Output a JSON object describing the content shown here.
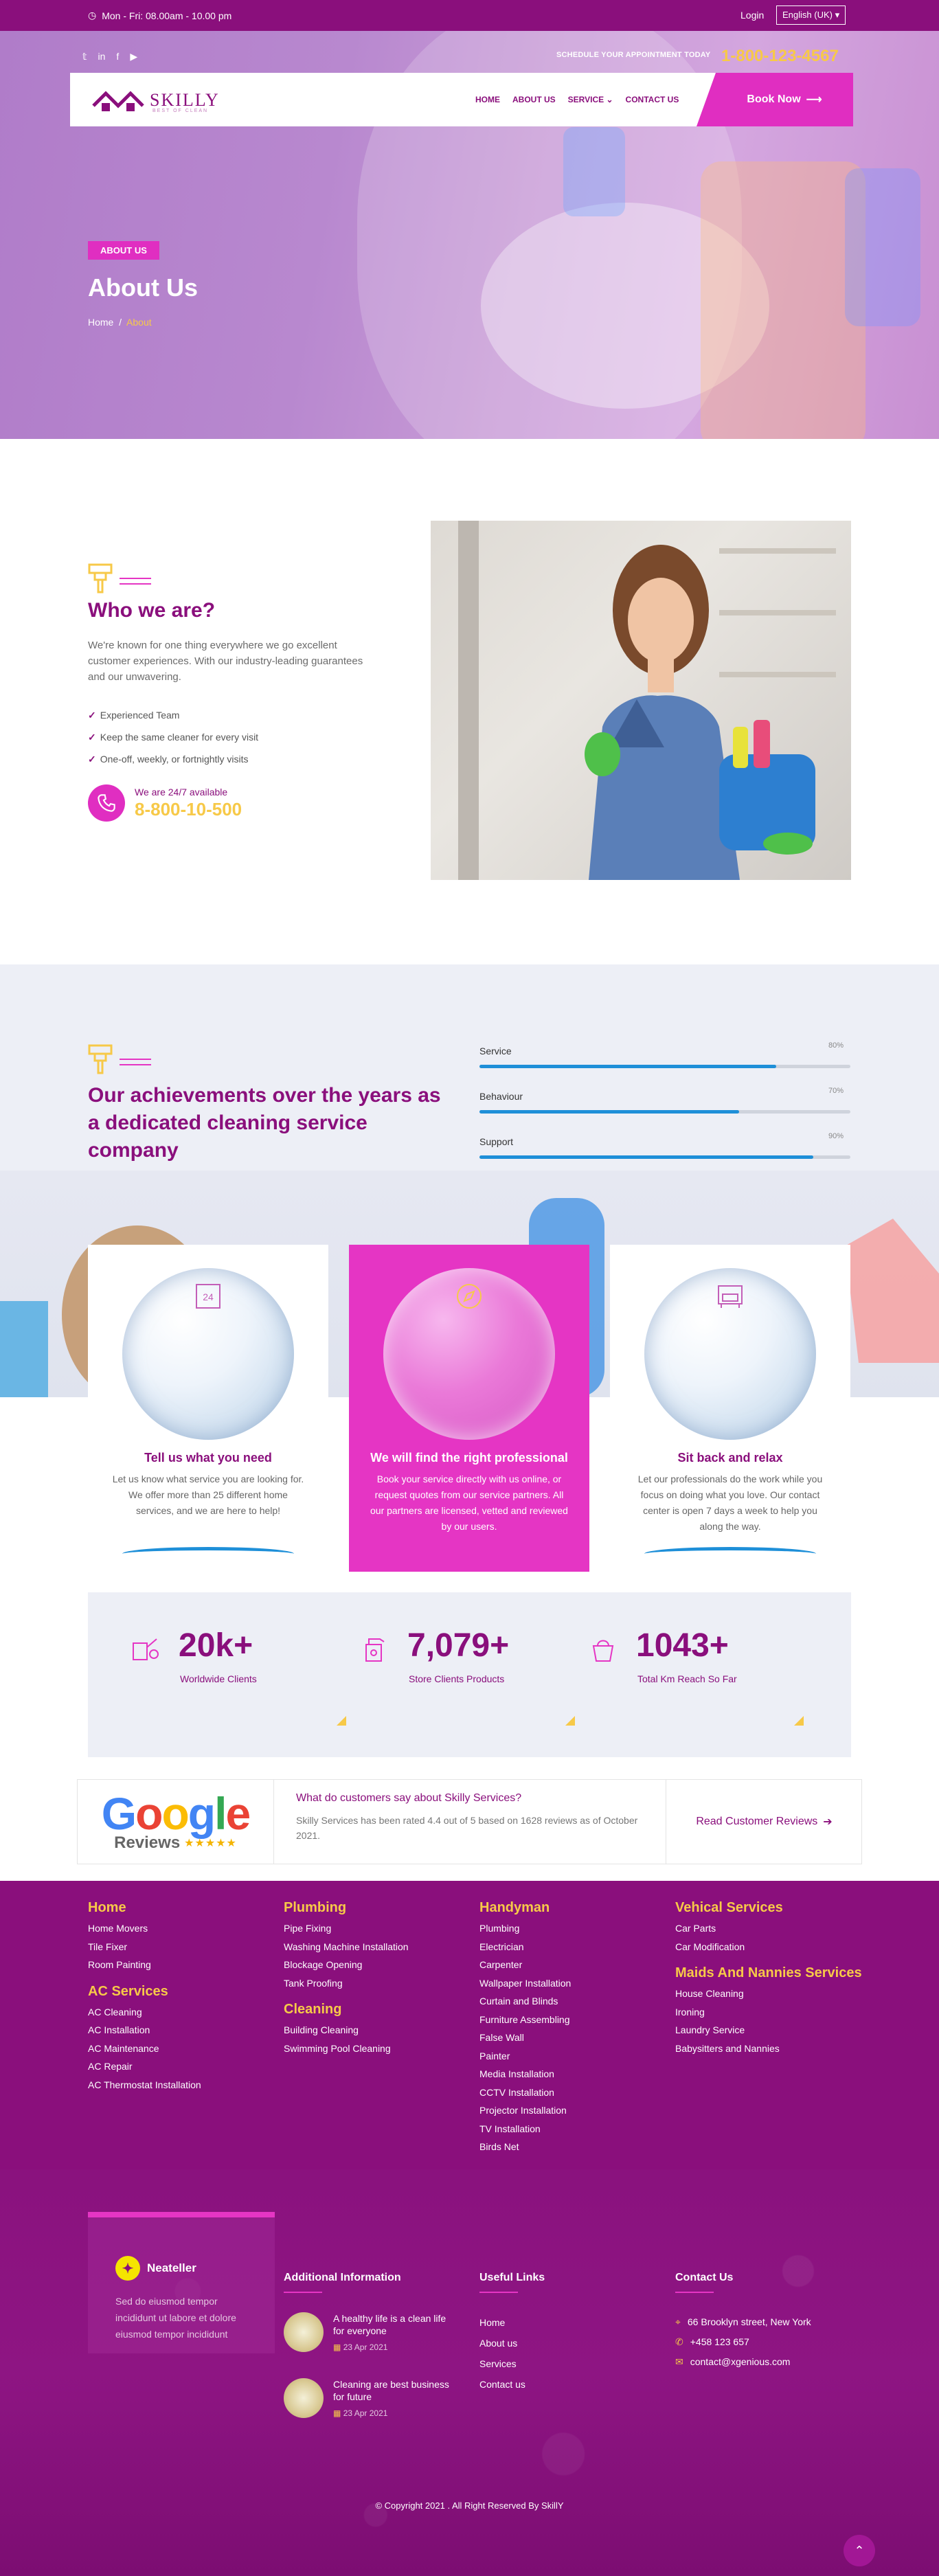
{
  "topbar": {
    "hours": "Mon - Fri: 08.00am - 10.00 pm",
    "login": "Login",
    "language": "English (UK)"
  },
  "header": {
    "schedule_label": "SCHEDULE YOUR APPOINTMENT TODAY",
    "phone": "1-800-123-4567",
    "logo_name": "SKILLY",
    "logo_tagline": "BEST OF CLEAN",
    "menu": [
      "HOME",
      "ABOUT US",
      "SERVICE",
      "CONTACT US"
    ],
    "book_label": "Book Now"
  },
  "hero": {
    "badge": "ABOUT US",
    "title": "About Us",
    "crumb_home": "Home",
    "crumb_sep": "/",
    "crumb_current": "About"
  },
  "who": {
    "title": "Who we are?",
    "text": "We're known for one thing everywhere we go excellent customer experiences. With our industry-leading guarantees and our unwavering.",
    "checks": [
      "Experienced Team",
      "Keep the same cleaner for every visit",
      "One-off, weekly, or fortnightly visits"
    ],
    "call_label": "We are 24/7 available",
    "call_number": "8-800-10-500"
  },
  "achievements": {
    "title": "Our achievements over the years as a dedicated cleaning service company",
    "bars": [
      {
        "label": "Service",
        "pct_text": "80%",
        "value": 0.8
      },
      {
        "label": "Behaviour",
        "pct_text": "70%",
        "value": 0.7
      },
      {
        "label": "Support",
        "pct_text": "90%",
        "value": 0.9
      }
    ]
  },
  "cards": [
    {
      "title": "Tell us what you need",
      "text": "Let us know what service you are looking for. We offer more than 25 different home services, and we are here to help!"
    },
    {
      "title": "We will find the right professional",
      "text": "Book your service directly with us online, or request quotes from our service partners. All our partners are licensed, vetted and reviewed by our users."
    },
    {
      "title": "Sit back and relax",
      "text": "Let our professionals do the work while you focus on doing what you love. Our contact center is open 7 days a week to help you along the way."
    }
  ],
  "stats": [
    {
      "number": "20k+",
      "label": "Worldwide Clients"
    },
    {
      "number": "7,079+",
      "label": "Store Clients Products"
    },
    {
      "number": "1043+",
      "label": "Total Km Reach So Far"
    }
  ],
  "review": {
    "google": "Google",
    "reviews_word": "Reviews",
    "stars": "★★★★★",
    "question": "What do customers say about Skilly Services?",
    "text": "Skilly Services has been rated 4.4 out of 5 based on 1628 reviews as of October 2021.",
    "link": "Read Customer Reviews"
  },
  "footer_services": [
    {
      "heading": "Home",
      "items": [
        "Home Movers",
        "Tile Fixer",
        "Room Painting"
      ],
      "heading2": "AC Services",
      "items2": [
        "AC Cleaning",
        "AC Installation",
        "AC Maintenance",
        "AC Repair",
        "AC Thermostat Installation"
      ]
    },
    {
      "heading": "Plumbing",
      "items": [
        "Pipe Fixing",
        "Washing Machine Installation",
        "Blockage Opening",
        "Tank Proofing"
      ],
      "heading2": "Cleaning",
      "items2": [
        "Building Cleaning",
        "Swimming Pool Cleaning"
      ]
    },
    {
      "heading": "Handyman",
      "items": [
        "Plumbing",
        "Electrician",
        "Carpenter",
        "Wallpaper Installation",
        "Curtain and Blinds",
        "Furniture Assembling",
        "False Wall",
        "Painter",
        "Media Installation",
        "CCTV Installation",
        "Projector Installation",
        "TV Installation",
        "Birds Net"
      ]
    },
    {
      "heading": "Vehical Services",
      "items": [
        "Car Parts",
        "Car Modification"
      ],
      "heading2": "Maids And Nannies Services",
      "items2": [
        "House Cleaning",
        "Ironing",
        "Laundry Service",
        "Babysitters and Nannies"
      ]
    }
  ],
  "footer": {
    "brand": "Neateller",
    "brand_text": "Sed do eiusmod tempor incididunt ut labore et dolore eiusmod tempor incididunt",
    "additional_heading": "Additional Information",
    "posts": [
      {
        "title": "A healthy life is a clean life for everyone",
        "date": "23 Apr 2021"
      },
      {
        "title": "Cleaning are best business for future",
        "date": "23 Apr 2021"
      }
    ],
    "useful_heading": "Useful Links",
    "useful_links": [
      "Home",
      "About us",
      "Services",
      "Contact us"
    ],
    "contact_heading": "Contact Us",
    "address": "66 Brooklyn street, New York",
    "phone": "+458 123 657",
    "email": "contact@xgenious.com",
    "copyright": "© Copyright 2021 . All Right Reserved By SkillY"
  },
  "colors": {
    "brand": "#8a0f7c",
    "accent": "#e535c4",
    "yellow": "#f7c948",
    "blue": "#1e8fd8"
  }
}
